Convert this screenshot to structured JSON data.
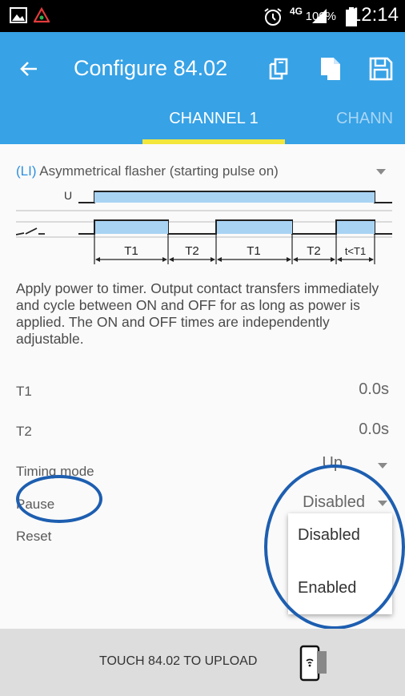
{
  "status_bar": {
    "network": "4G",
    "battery": "100%",
    "time": "12:14"
  },
  "app_bar": {
    "title": "Configure 84.02",
    "tabs": [
      {
        "label": "CHANNEL 1",
        "active": true
      },
      {
        "label": "CHANN",
        "active": false
      }
    ]
  },
  "function_select": {
    "code": "(LI)",
    "label": "Asymmetrical flasher (starting pulse on)"
  },
  "diagram": {
    "supply_label": "U",
    "segments": [
      "T1",
      "T2",
      "T1",
      "T2",
      "t<T1"
    ]
  },
  "description": "Apply power to timer. Output contact transfers immediately and cycle between ON and OFF for as long as power is applied. The ON and OFF times are independently adjustable.",
  "params": [
    {
      "label": "T1",
      "value": "0.0s"
    },
    {
      "label": "T2",
      "value": "0.0s"
    },
    {
      "label": "Timing mode",
      "value": "Up"
    },
    {
      "label": "Pause",
      "value": "Disabled"
    },
    {
      "label": "Reset",
      "value": ""
    }
  ],
  "pause_dropdown_options": [
    "Disabled",
    "Enabled"
  ],
  "bottom_bar": {
    "text": "TOUCH 84.02 TO UPLOAD"
  },
  "colors": {
    "app_bar": "#37a2e6",
    "tab_indicator": "#f3e63c",
    "highlight_ring": "#1d5eb0",
    "diagram_fill": "#a9d3f3"
  }
}
